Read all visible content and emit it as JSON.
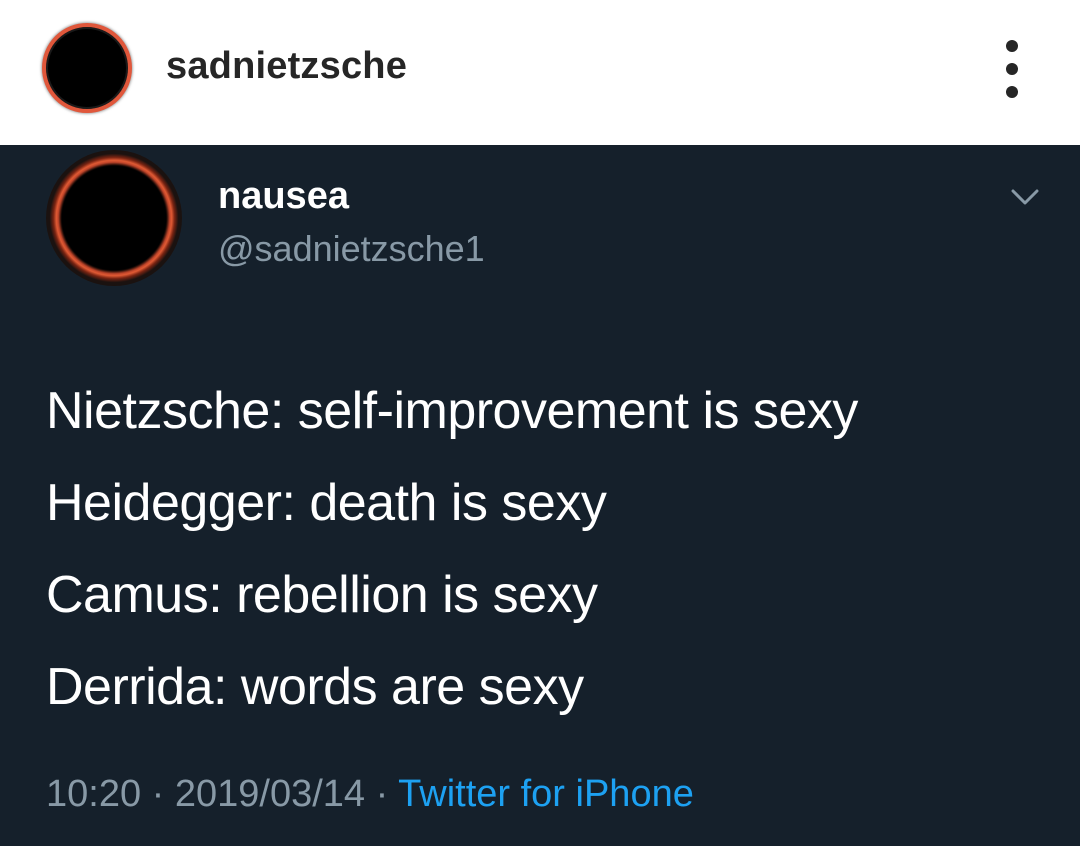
{
  "instagram_header": {
    "username": "sadnietzsche",
    "avatar_icon": "profile-avatar-red-ring",
    "more_icon": "vertical-ellipsis-icon"
  },
  "tweet": {
    "display_name": "nausea",
    "handle": "@sadnietzsche1",
    "chevron_icon": "chevron-down-icon",
    "lines": [
      "Nietzsche: self-improvement is sexy",
      "Heidegger: death is sexy",
      "Camus: rebellion is sexy",
      "Derrida: words are sexy"
    ],
    "time": "10:20",
    "separator": "·",
    "date": "2019/03/14",
    "source": "Twitter for iPhone",
    "colors": {
      "background": "#15202b",
      "secondary_text": "#8899a6",
      "link": "#1da1f2",
      "avatar_ring": "#e05a34"
    }
  }
}
